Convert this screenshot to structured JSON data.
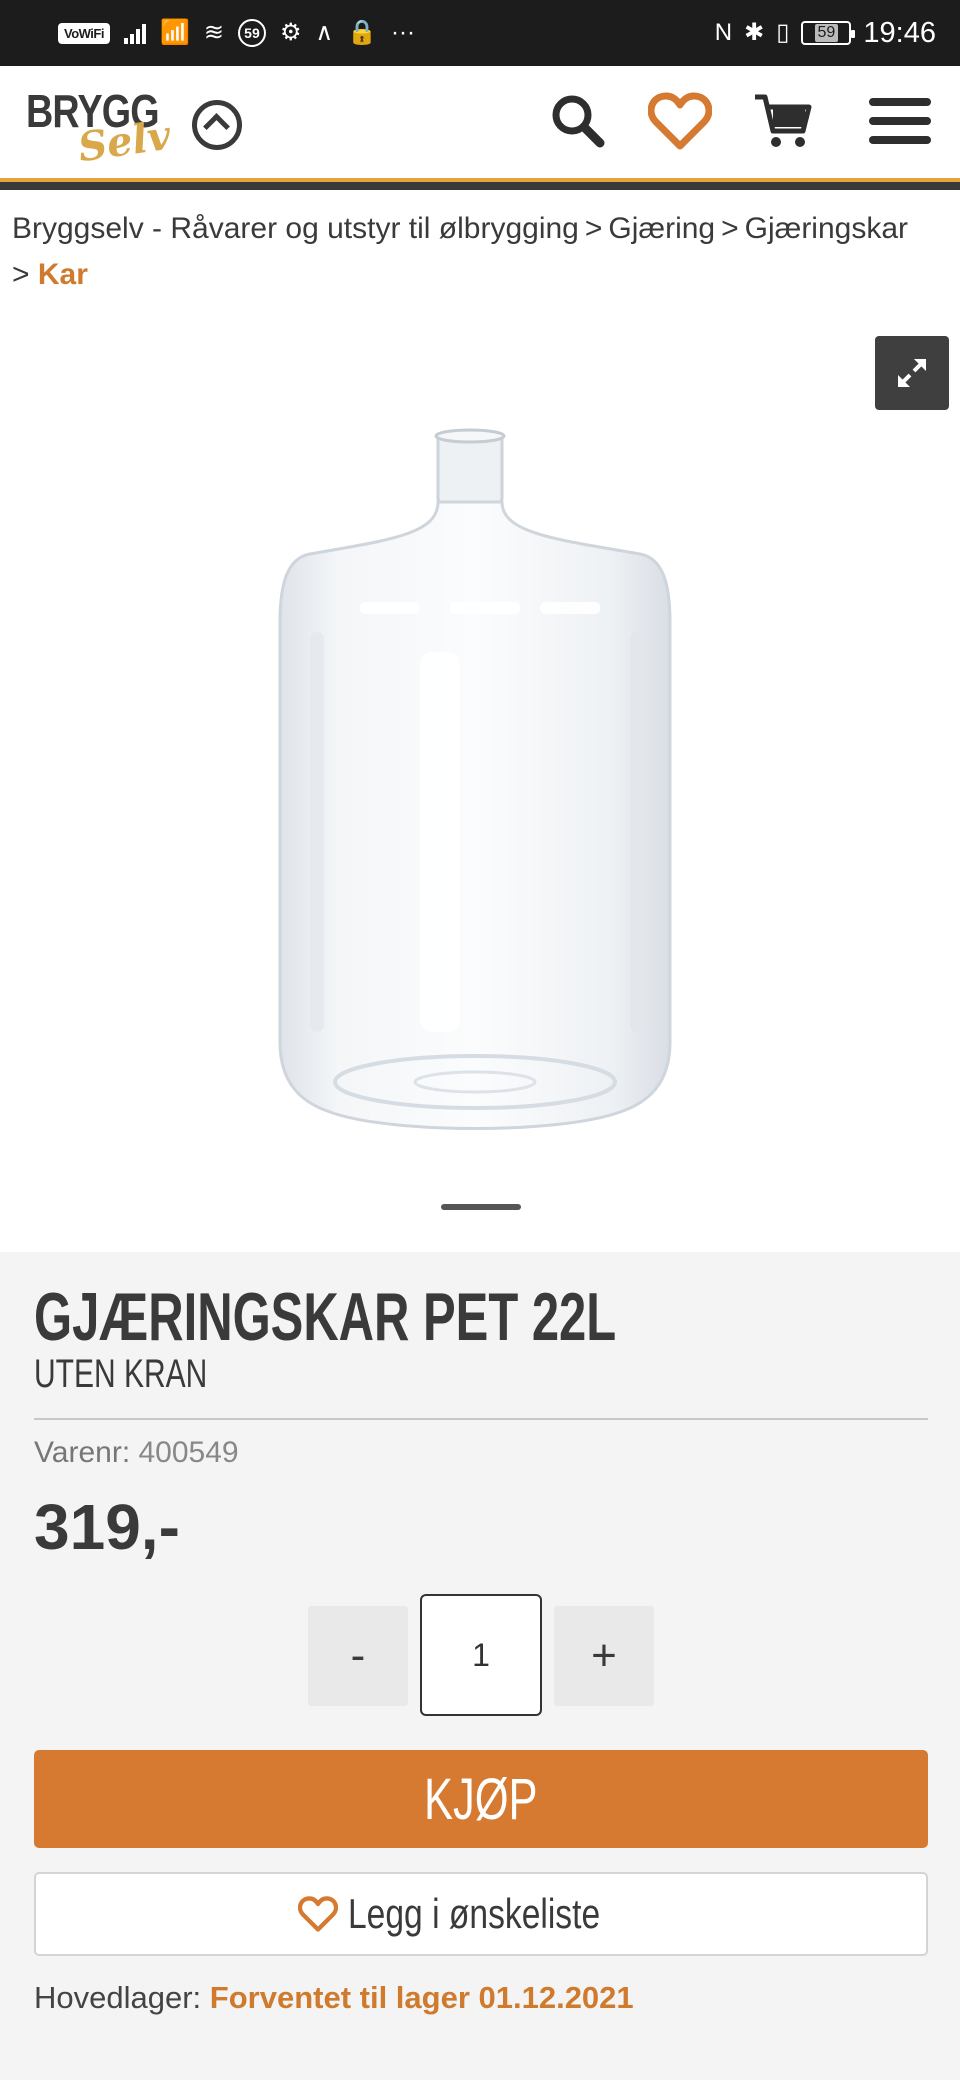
{
  "status_bar": {
    "vowifi": "VoWiFi",
    "circle_badge": "59",
    "battery": "59",
    "time": "19:46",
    "more": "···"
  },
  "header": {
    "logo_top": "BRYGG",
    "logo_bottom": "Selv",
    "icons": [
      "search-icon",
      "heart-icon",
      "cart-icon",
      "menu-icon"
    ],
    "accent_color": "#d57a30"
  },
  "breadcrumb": {
    "items": [
      "Bryggselv - Råvarer og utstyr til ølbrygging",
      "Gjæring",
      "Gjæringskar"
    ],
    "current": "Kar",
    "separator": ">"
  },
  "product": {
    "title": "GJÆRINGSKAR PET 22L",
    "subtitle": "UTEN KRAN",
    "sku_label": "Varenr:",
    "sku_value": "400549",
    "price": "319,-",
    "quantity": "1",
    "minus_label": "-",
    "plus_label": "+",
    "buy_label": "KJØP",
    "wishlist_label": "Legg i ønskeliste",
    "stock_label": "Hovedlager:",
    "stock_value": "Forventet til lager 01.12.2021"
  }
}
